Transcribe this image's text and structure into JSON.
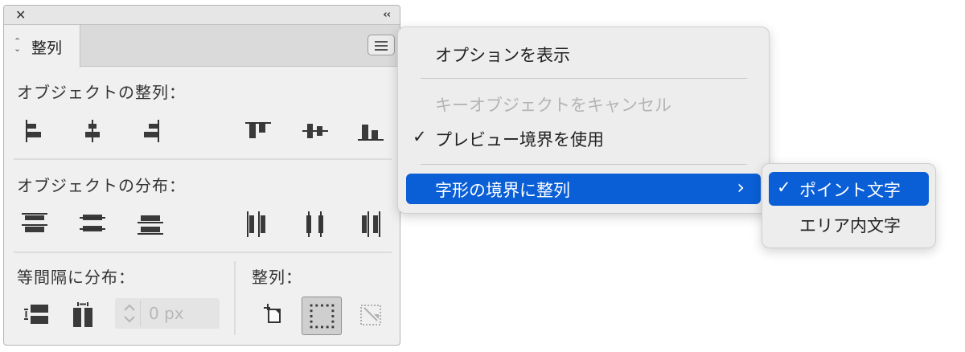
{
  "panel": {
    "close_icon": "close-icon",
    "collapse_icon": "chevrons-left-icon",
    "tab_label": "整列",
    "sections": {
      "align_objects": "オブジェクトの整列：",
      "distribute_objects": "オブジェクトの分布：",
      "distribute_spacing": "等間隔に分布：",
      "align_to": "整列："
    },
    "spacing_value": "0 px"
  },
  "menu": {
    "items": [
      {
        "label": "オプションを表示",
        "enabled": true,
        "checked": false
      },
      {
        "label": "キーオブジェクトをキャンセル",
        "enabled": false,
        "checked": false
      },
      {
        "label": "プレビュー境界を使用",
        "enabled": true,
        "checked": true
      },
      {
        "label": "字形の境界に整列",
        "enabled": true,
        "checked": false,
        "highlighted": true,
        "has_submenu": true
      }
    ],
    "check_mark": "✓",
    "submenu_arrow": "›"
  },
  "submenu": {
    "items": [
      {
        "label": "ポイント文字",
        "checked": true,
        "highlighted": true
      },
      {
        "label": "エリア内文字",
        "checked": false
      }
    ]
  },
  "colors": {
    "highlight": "#0a5fd6",
    "panel_bg": "#f0f0f0",
    "menu_bg": "#ededed",
    "icon_dark": "#3a3a3a"
  }
}
